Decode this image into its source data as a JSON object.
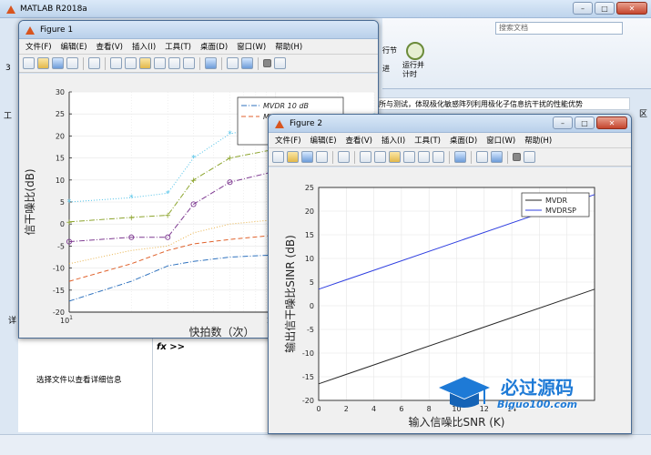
{
  "app": {
    "title": "MATLAB R2018a",
    "search_placeholder": "搜索文档",
    "ribbon_btn_1": "行节",
    "ribbon_btn_2": "运行并\n计时",
    "ribbon_btn_3": "进",
    "strip_text": "所与测试，体现极化敏感阵列利用极化子信息抗干扰的性能优势",
    "left_pane_text": "选择文件以查看详细信息",
    "fx_prompt": "fx >>",
    "side_char": "工",
    "side_label": "区",
    "detail_label": "详",
    "mini_label": "当",
    "mini_label2": "3"
  },
  "figure1": {
    "title": "Figure 1",
    "menu": [
      "文件(F)",
      "编辑(E)",
      "查看(V)",
      "插入(I)",
      "工具(T)",
      "桌面(D)",
      "窗口(W)",
      "帮助(H)"
    ],
    "xlabel": "快拍数（次）",
    "ylabel": "信干噪比(dB)",
    "legend": [
      {
        "label": "MVDR  10 dB",
        "color": "#2f72be",
        "dash": "6,2,1,2"
      },
      {
        "label": "MVDR 15 dB",
        "color": "#e0622c",
        "dash": "5,3"
      }
    ],
    "chart_data": {
      "type": "line",
      "xscale": "log",
      "xlim": [
        10,
        300
      ],
      "ylim": [
        -20,
        30
      ],
      "xtick_labels": [
        "10",
        "10",
        "2"
      ],
      "ytick_labels": [
        "30",
        "25",
        "20",
        "15",
        "10",
        "5",
        "0",
        "-5",
        "-10",
        "-15",
        "-20"
      ],
      "series": [
        {
          "name": "MVDR  10 dB",
          "color": "#2f72be",
          "style": "dashdot",
          "x": [
            10,
            20,
            30,
            40,
            60,
            100,
            150,
            200,
            300
          ],
          "y": [
            -17.5,
            -13,
            -9.5,
            -8.5,
            -7.5,
            -7,
            -6.5,
            -6.5,
            -6
          ]
        },
        {
          "name": "MVDR 15 dB",
          "color": "#e0622c",
          "style": "dash",
          "x": [
            10,
            20,
            30,
            40,
            60,
            100,
            150,
            200,
            300
          ],
          "y": [
            -13,
            -9,
            -6,
            -4.5,
            -3.5,
            -2.5,
            -2.5,
            -2.5,
            -2
          ]
        },
        {
          "color": "#e8b24a",
          "style": "dot",
          "x": [
            10,
            20,
            30,
            40,
            60,
            100,
            150,
            200,
            300
          ],
          "y": [
            -9,
            -6,
            -5,
            -2,
            0,
            1,
            2,
            2,
            2.5
          ]
        },
        {
          "color": "#7e3a91",
          "style": "dashdot",
          "marker": "o",
          "x": [
            10,
            20,
            30,
            40,
            60,
            100,
            150,
            200,
            300
          ],
          "y": [
            -4,
            -3,
            -3,
            4.5,
            9.5,
            12,
            13,
            13.5,
            14
          ]
        },
        {
          "color": "#8ca42c",
          "style": "dashdot",
          "marker": "+",
          "x": [
            10,
            20,
            30,
            40,
            60,
            100,
            150,
            200,
            300
          ],
          "y": [
            0.5,
            1.5,
            2,
            10,
            15,
            17,
            18,
            18.5,
            19
          ]
        },
        {
          "color": "#4fc2e8",
          "style": "dot",
          "marker": "*",
          "x": [
            10,
            20,
            30,
            40,
            60,
            100,
            150,
            200,
            300
          ],
          "y": [
            5,
            6,
            7,
            15,
            20.5,
            22.5,
            23.5,
            24,
            24.5
          ]
        }
      ]
    }
  },
  "figure2": {
    "title": "Figure 2",
    "menu": [
      "文件(F)",
      "编辑(E)",
      "查看(V)",
      "插入(I)",
      "工具(T)",
      "桌面(D)",
      "窗口(W)",
      "帮助(H)"
    ],
    "xlabel": "输入信噪比SNR (K)",
    "ylabel": "输出信干噪比SINR (dB)",
    "chart_data": {
      "type": "line",
      "xlim": [
        0,
        20
      ],
      "ylim": [
        -20,
        25
      ],
      "xtick_labels": [
        "0",
        "2",
        "4",
        "6",
        "8",
        "10",
        "12",
        "14"
      ],
      "ytick_labels": [
        "25",
        "20",
        "15",
        "10",
        "5",
        "0",
        "-5",
        "-10",
        "-15",
        "-20"
      ],
      "series": [
        {
          "name": "MVDR",
          "color": "#262626",
          "x": [
            0,
            20
          ],
          "y": [
            -16.5,
            3.5
          ]
        },
        {
          "name": "MVDRSP",
          "color": "#2f3fe0",
          "x": [
            0,
            20
          ],
          "y": [
            3.5,
            23.5
          ]
        }
      ]
    }
  },
  "watermark": {
    "line1": "必过源码",
    "line2": "Biguo100.com"
  }
}
